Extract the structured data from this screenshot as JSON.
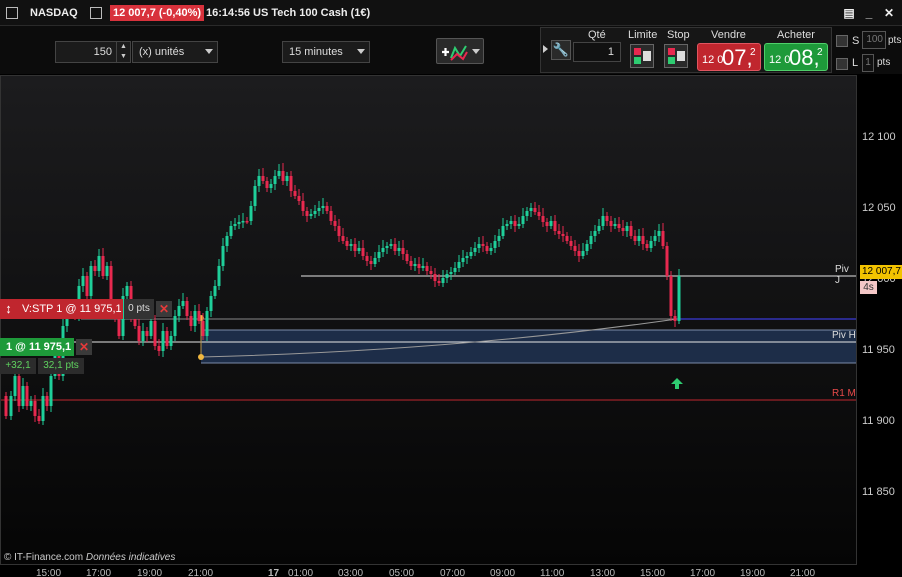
{
  "titlebar": {
    "symbol": "NASDAQ",
    "change": "12 007,7 (-0,40%)",
    "time": "16:14:56",
    "instrument": "US Tech 100 Cash (1€)"
  },
  "toolbar": {
    "quantity_value": "150",
    "unit_label": "(x) unités",
    "timeframe": "15 minutes",
    "qty_label": "Qté",
    "qty_value": "1",
    "limit_label": "Limite",
    "stop_label": "Stop",
    "sell_label": "Vendre",
    "buy_label": "Acheter",
    "sell_price_prefix": "12 0",
    "sell_price_big": "07,",
    "sell_price_sup": "2",
    "buy_price_prefix": "12 0",
    "buy_price_big": "08,",
    "buy_price_sup": "2",
    "s_label": "S",
    "s_value": "100",
    "pts_label": "pts",
    "l_label": "L",
    "l_value": "1",
    "l_unit": "pts"
  },
  "chart": {
    "y_ticks": [
      "12 100",
      "12 050",
      "12 000",
      "11 950",
      "11 900",
      "11 850"
    ],
    "x_ticks": [
      "15:00",
      "17:00",
      "19:00",
      "21:00",
      "17",
      "01:00",
      "03:00",
      "05:00",
      "07:00",
      "09:00",
      "11:00",
      "13:00",
      "15:00",
      "17:00",
      "19:00",
      "21:00"
    ],
    "current_price": "12 007,7",
    "age": "4s",
    "piv_j_label": "Piv J",
    "piv_h_label": "Piv H",
    "r1_label": "R1 M",
    "footer": "© IT-Finance.com",
    "footer_italic": "Données indicatives"
  },
  "orders": {
    "stop_label": "V:STP  1 @ 11 975,1",
    "stop_pts": "0 pts",
    "position_label": "1 @ 11 975,1",
    "pnl_value": "+32,1",
    "pnl_pts": "32,1 pts"
  },
  "colors": {
    "bull": "#1fcf9a",
    "bear": "#e8294f",
    "sell": "#c0262e",
    "buy": "#1e9a3a",
    "price_tag": "#f2c300"
  },
  "icons": {
    "window_menu": "window-menu-icon",
    "minimize": "minimize-icon",
    "close": "close-icon",
    "wrench": "wrench-icon",
    "chart_tools": "chart-tools-icon",
    "buy_arrow": "up-arrow-icon"
  }
}
